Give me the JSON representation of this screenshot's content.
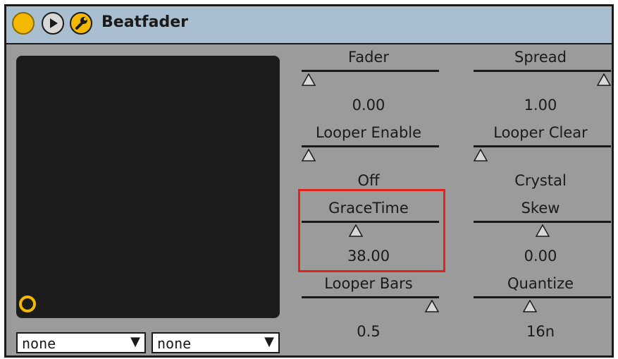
{
  "app": {
    "title": "Beatfader"
  },
  "dropdowns": {
    "left": {
      "value": "none"
    },
    "right": {
      "value": "none"
    }
  },
  "controls": {
    "fader": {
      "label": "Fader",
      "value": "0.00",
      "level": 0.0
    },
    "spread": {
      "label": "Spread",
      "value": "1.00",
      "level": 1.0
    },
    "looper_enable": {
      "label": "Looper Enable",
      "value": "Off",
      "level": 0.0
    },
    "looper_clear": {
      "label": "Looper Clear",
      "value": "Crystal",
      "level": 0.0
    },
    "grace_time": {
      "label": "GraceTime",
      "value": "38.00",
      "level": 0.38
    },
    "skew": {
      "label": "Skew",
      "value": "0.00",
      "level": 0.5
    },
    "looper_bars": {
      "label": "Looper Bars",
      "value": "0.5",
      "level": 1.0
    },
    "quantize": {
      "label": "Quantize",
      "value": "16n",
      "level": 0.4
    }
  },
  "colors": {
    "accent": "#f5b800",
    "highlight": "#e2231a",
    "panel": "#9b9b9b",
    "titlebar": "#a9bfd0"
  }
}
